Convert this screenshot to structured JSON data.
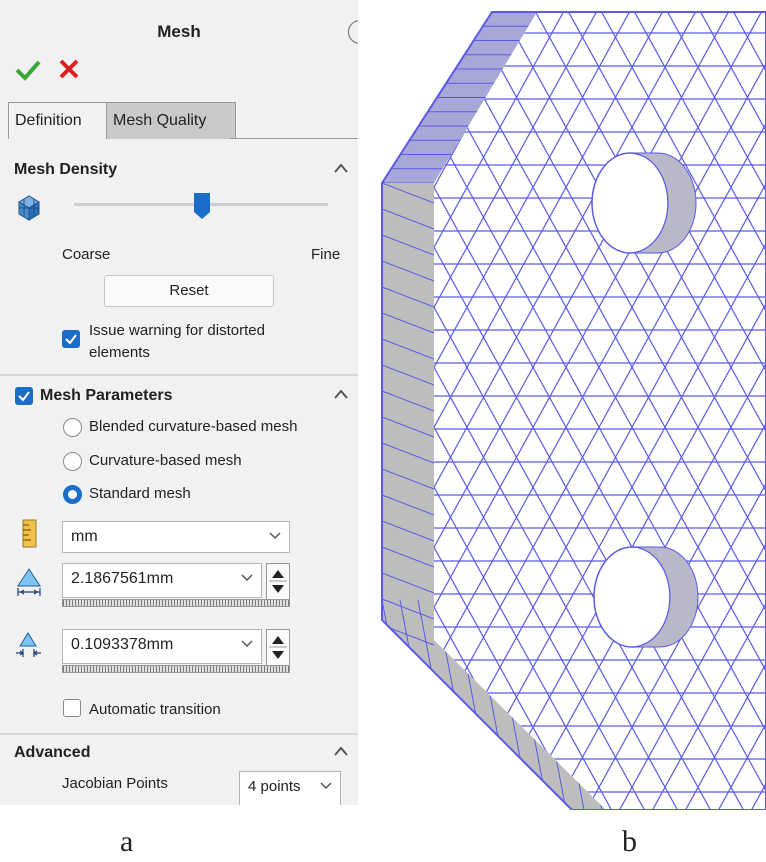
{
  "panel": {
    "title": "Mesh",
    "tabs": {
      "definition": "Definition",
      "mesh_quality": "Mesh Quality"
    },
    "density": {
      "title": "Mesh Density",
      "slider_level": 0.5,
      "coarse": "Coarse",
      "fine": "Fine",
      "reset": "Reset",
      "warning": "Issue warning for distorted elements",
      "warning_line1": "Issue warning for distorted",
      "warning_line2": "elements",
      "warning_checked": true
    },
    "parameters": {
      "title": "Mesh Parameters",
      "checked": true,
      "options": [
        "Blended curvature-based mesh",
        "Curvature-based mesh",
        "Standard mesh"
      ],
      "selected": "Standard mesh",
      "unit": "mm",
      "global_size": "2.1867561mm",
      "tolerance": "0.1093378mm",
      "auto_transition": "Automatic transition",
      "auto_transition_checked": false
    },
    "advanced": {
      "title": "Advanced",
      "jacobian_label": "Jacobian Points",
      "jacobian_value": "4 points"
    }
  },
  "captions": {
    "a": "a",
    "b": "b"
  },
  "colors": {
    "accent": "#1a6ec7",
    "mesh": "#5a5ae6",
    "ok": "#3aa63a",
    "cancel": "#e02020"
  }
}
